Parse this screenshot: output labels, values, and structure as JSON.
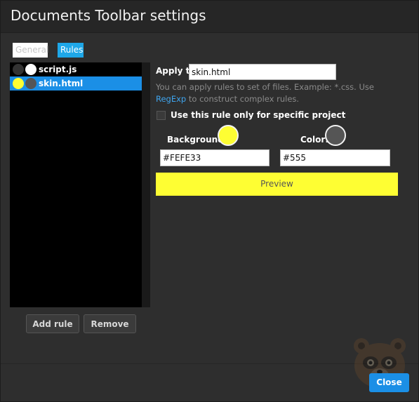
{
  "dialog": {
    "title": "Documents Toolbar settings"
  },
  "tabs": [
    {
      "label": "General",
      "active": false
    },
    {
      "label": "Rules",
      "active": true
    }
  ],
  "rules": [
    {
      "label": "script.js",
      "background": "#333333",
      "color": "#ffffff",
      "selected": false
    },
    {
      "label": "skin.html",
      "background": "#FEFE33",
      "color": "#555555",
      "selected": true
    }
  ],
  "buttons": {
    "add_rule": "Add rule",
    "remove": "Remove",
    "close": "Close"
  },
  "editor": {
    "apply_to_label": "Apply to",
    "apply_to_value": "skin.html",
    "help_text_before": "You can apply rules to set of files. Example: *.css. Use ",
    "help_link": "RegExp",
    "help_text_after": " to construct complex rules.",
    "project_checkbox_label": "Use this rule only for specific project",
    "project_checkbox_checked": false,
    "background_label": "Background:",
    "background_value": "#FEFE33",
    "color_label": "Color:",
    "color_value": "#555",
    "preview_label": "Preview"
  },
  "colors": {
    "accent": "#1b8fe6",
    "preview_background": "#FEFE33",
    "preview_text": "#555555"
  }
}
